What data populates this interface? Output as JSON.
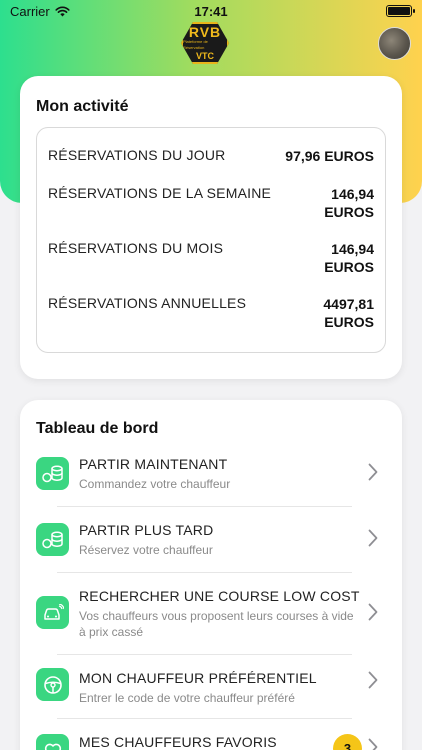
{
  "status_bar": {
    "carrier": "Carrier",
    "time": "17:41"
  },
  "logo": {
    "top": "RVB",
    "middle": "Plateforme de Réservation",
    "bottom": "VTC"
  },
  "colors": {
    "accent_green": "#3ad681",
    "gradient_start": "#2ddf8e",
    "gradient_end": "#ffd24e",
    "badge": "#f5c518"
  },
  "activity": {
    "title": "Mon activité",
    "rows": [
      {
        "label": "RÉSERVATIONS DU JOUR",
        "value": "97,96 EUROS"
      },
      {
        "label": "RÉSERVATIONS DE LA SEMAINE",
        "value": "146,94 EUROS"
      },
      {
        "label": "RÉSERVATIONS DU MOIS",
        "value": "146,94 EUROS"
      },
      {
        "label": "RÉSERVATIONS ANNUELLES",
        "value": "4497,81 EUROS"
      }
    ]
  },
  "dashboard": {
    "title": "Tableau de bord",
    "items": [
      {
        "title": "PARTIR MAINTENANT",
        "subtitle": "Commandez votre chauffeur",
        "icon": "coins-car-icon"
      },
      {
        "title": "PARTIR PLUS TARD",
        "subtitle": "Réservez votre chauffeur",
        "icon": "coins-car-icon"
      },
      {
        "title": "RECHERCHER UNE COURSE LOW COST",
        "subtitle": "Vos chauffeurs vous proposent leurs courses à vide à prix cassé",
        "icon": "car-signal-icon"
      },
      {
        "title": "MON CHAUFFEUR PRÉFÉRENTIEL",
        "subtitle": "Entrer le code de votre chauffeur préféré",
        "icon": "steering-wheel-icon"
      },
      {
        "title": "MES CHAUFFEURS FAVORIS",
        "subtitle": "",
        "icon": "heart-icon",
        "badge": "3"
      }
    ]
  }
}
